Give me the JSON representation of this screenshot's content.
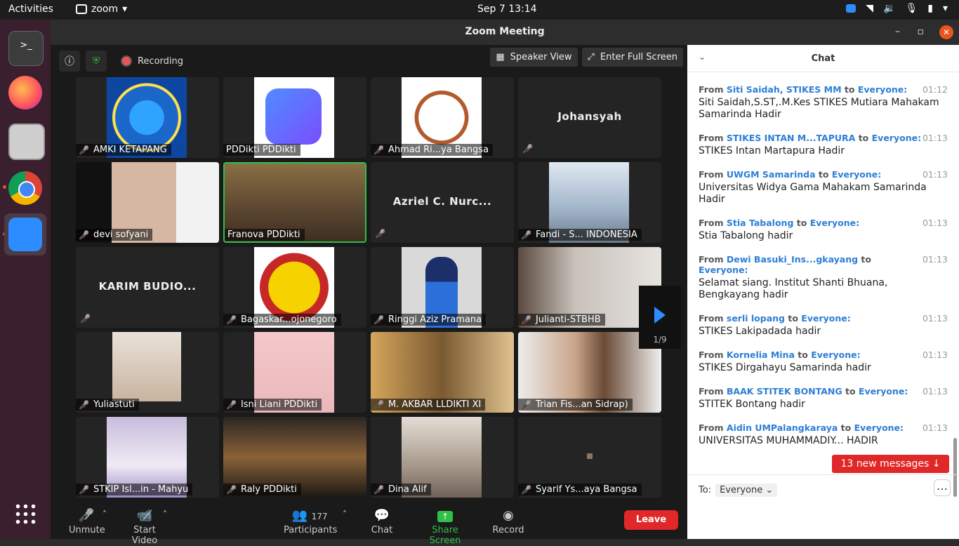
{
  "topbar": {
    "activities": "Activities",
    "app_name": "zoom",
    "clock": "Sep 7  13:14"
  },
  "window": {
    "title": "Zoom Meeting"
  },
  "toolbar": {
    "recording": "Recording",
    "speaker_view": "Speaker View",
    "full_screen": "Enter Full Screen"
  },
  "tiles": [
    {
      "name": "AMKI KETAPANG",
      "kind": "logo-amki"
    },
    {
      "name": "PDDikti PDDikti",
      "kind": "logo-pddikti"
    },
    {
      "name": "Ahmad Ri...ya Bangsa",
      "kind": "logo-stikes"
    },
    {
      "name": "",
      "big": "Johansyah",
      "kind": "text"
    },
    {
      "name": "devi sofyani",
      "kind": "photo-devi"
    },
    {
      "name": "Franova PDDikti",
      "kind": "photo-franova"
    },
    {
      "name": "",
      "big": "Azriel C. Nurc...",
      "kind": "text"
    },
    {
      "name": "Fandi - S... INDONESIA",
      "kind": "photo-fandi"
    },
    {
      "name": "",
      "big": "KARIM BUDIO...",
      "kind": "text"
    },
    {
      "name": "Bagaskar...ojonegoro",
      "kind": "logo-bojonegoro"
    },
    {
      "name": "Ringgi Aziz Pramana",
      "kind": "photo-ringgi"
    },
    {
      "name": "Julianti-STBHB",
      "kind": "photo-julianti"
    },
    {
      "name": "Yuliastuti",
      "kind": "photo-yuliastuti"
    },
    {
      "name": "Isni Liani PDDikti",
      "kind": "photo-isni"
    },
    {
      "name": "M. AKBAR LLDIKTI XI",
      "kind": "photo-akbar"
    },
    {
      "name": "Trian Fis...an Sidrap)",
      "kind": "photo-trian"
    },
    {
      "name": "STKIP Isl...in - Mahyu",
      "kind": "photo-stkip"
    },
    {
      "name": "Raly PDDikti",
      "kind": "photo-raly"
    },
    {
      "name": "Dina Alif",
      "kind": "photo-dina"
    },
    {
      "name": "Syarif Ys...aya Bangsa",
      "kind": "photo-syarif"
    }
  ],
  "pager": {
    "label": "1/9"
  },
  "controls": {
    "unmute": "Unmute",
    "start_video": "Start Video",
    "participants": "Participants",
    "participants_count": "177",
    "chat": "Chat",
    "share_screen": "Share Screen",
    "record": "Record",
    "leave": "Leave"
  },
  "chat": {
    "title": "Chat",
    "messages": [
      {
        "from": "Siti Saidah, STIKES MM",
        "to": "Everyone:",
        "time": "01:12",
        "text": "Siti Saidah,S.ST,.M.Kes STIKES Mutiara Mahakam Samarinda Hadir"
      },
      {
        "from": "STIKES INTAN M...TAPURA",
        "to": "Everyone:",
        "time": "01:13",
        "text": "STIKES Intan Martapura Hadir"
      },
      {
        "from": "UWGM Samarinda",
        "to": "Everyone:",
        "time": "01:13",
        "text": "Universitas Widya Gama Mahakam Samarinda Hadir"
      },
      {
        "from": "Stia Tabalong",
        "to": "Everyone:",
        "time": "01:13",
        "text": "Stia Tabalong hadir"
      },
      {
        "from": "Dewi Basuki_Ins...gkayang",
        "to": "Everyone:",
        "time": "01:13",
        "text": "Selamat siang. Institut Shanti Bhuana, Bengkayang hadir"
      },
      {
        "from": "serli lopang",
        "to": "Everyone:",
        "time": "01:13",
        "text": "STIKES Lakipadada hadir"
      },
      {
        "from": "Kornelia Mina",
        "to": "Everyone:",
        "time": "01:13",
        "text": "STIKES Dirgahayu Samarinda hadir"
      },
      {
        "from": "BAAK STITEK BONTANG",
        "to": "Everyone:",
        "time": "01:13",
        "text": "STITEK Bontang hadir"
      },
      {
        "from": "Aidin UMPalangkaraya",
        "to": "Everyone:",
        "time": "01:13",
        "text": "UNIVERSITAS MUHAMMADIY... HADIR"
      }
    ],
    "from_label": "From",
    "to_label": "to",
    "new_messages": "13 new messages ↓",
    "to_prefix": "To:",
    "recipient": "Everyone"
  }
}
